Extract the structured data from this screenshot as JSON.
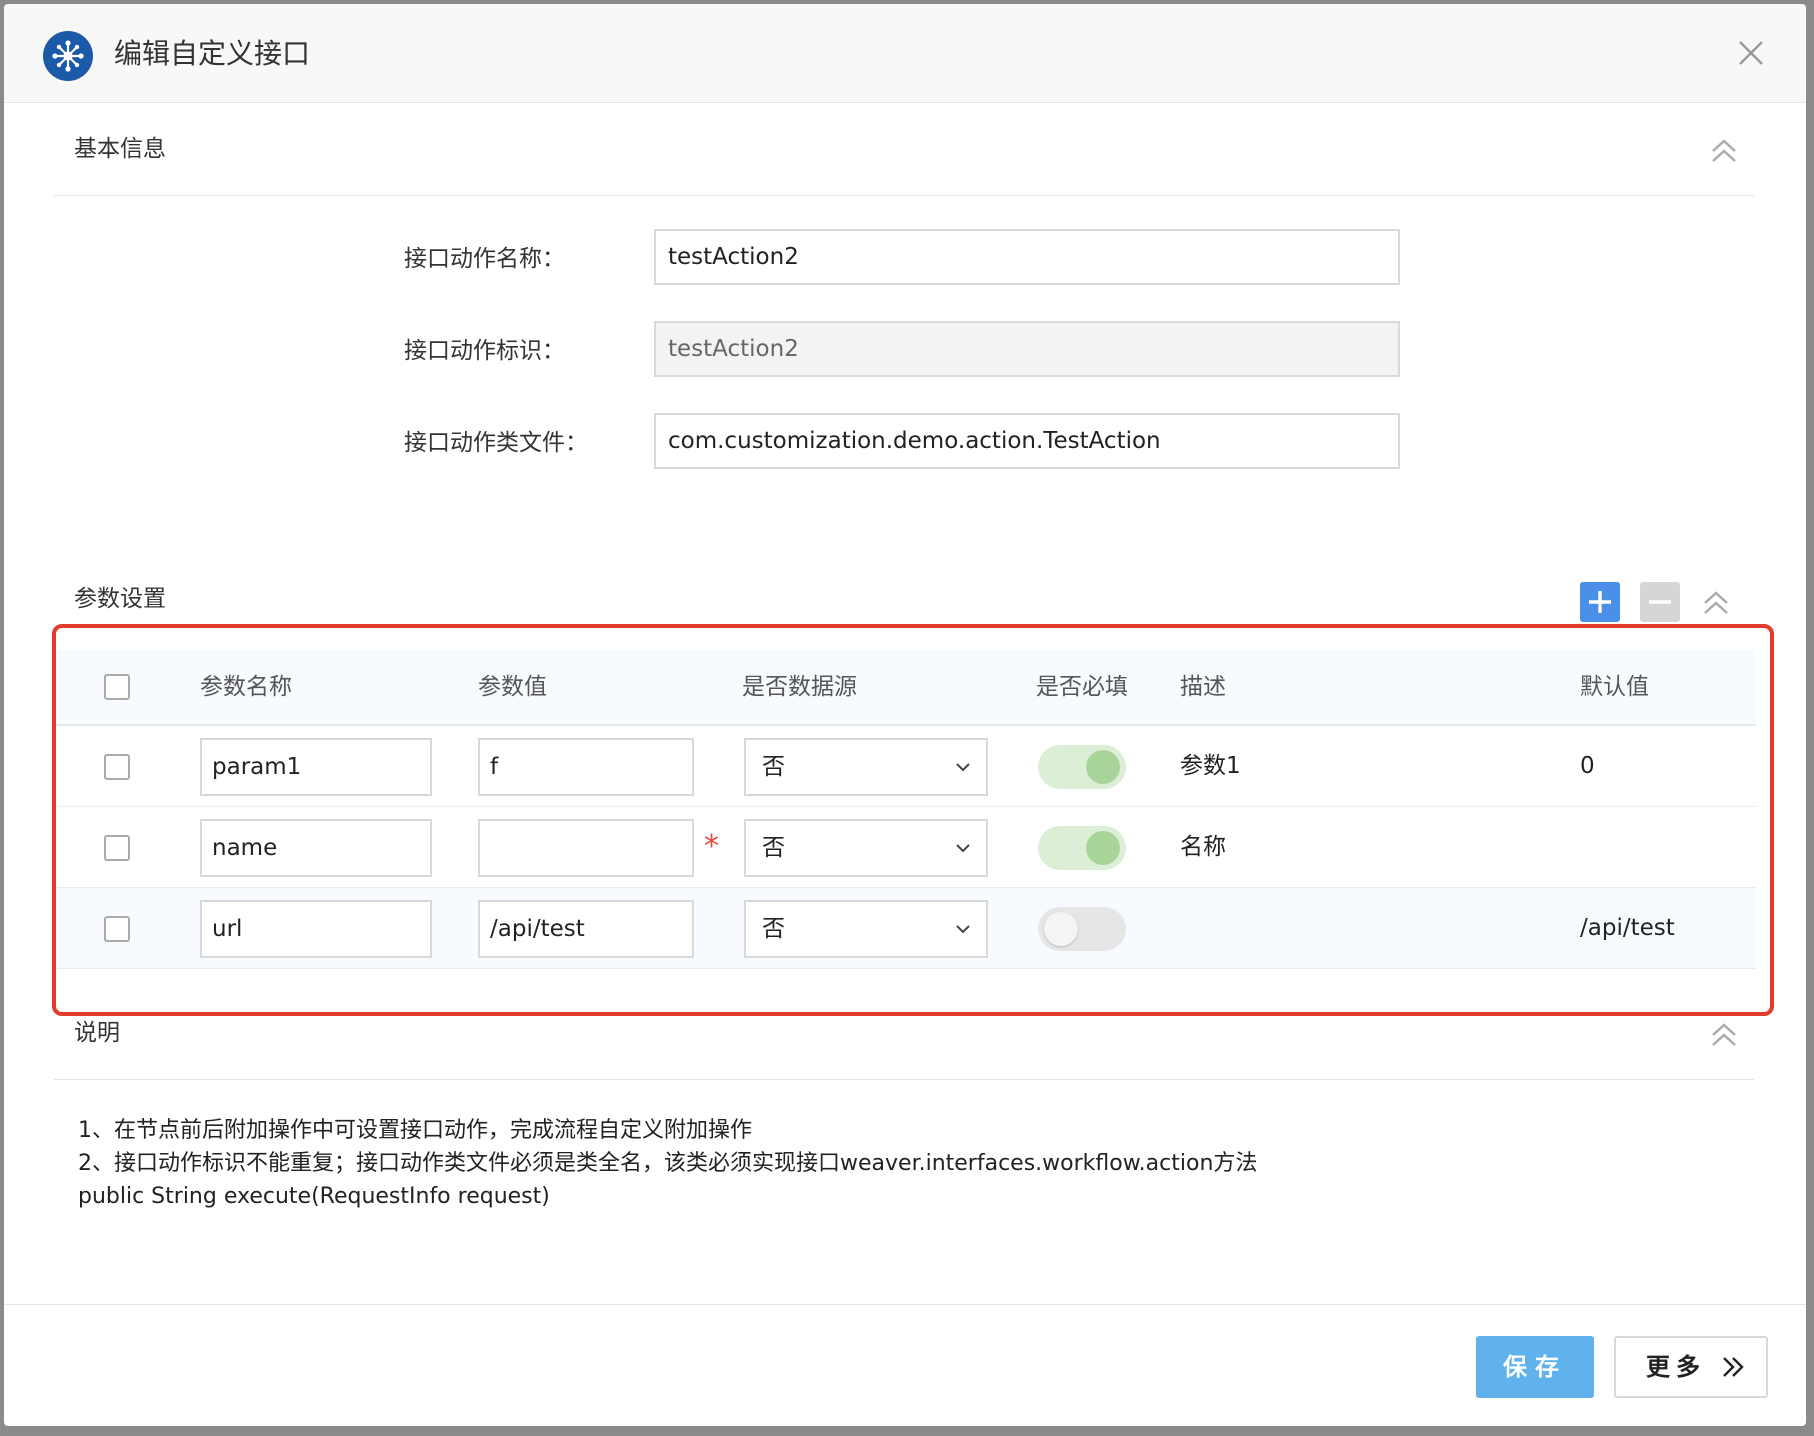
{
  "dialog": {
    "title": "编辑自定义接口"
  },
  "basic": {
    "section_title": "基本信息",
    "fields": [
      {
        "label": "接口动作名称：",
        "value": "testAction2",
        "disabled": false
      },
      {
        "label": "接口动作标识：",
        "value": "testAction2",
        "disabled": true
      },
      {
        "label": "接口动作类文件：",
        "value": "com.customization.demo.action.TestAction",
        "disabled": false
      }
    ]
  },
  "params": {
    "section_title": "参数设置",
    "columns": [
      "参数名称",
      "参数值",
      "是否数据源",
      "是否必填",
      "描述",
      "默认值"
    ],
    "rows": [
      {
        "name": "param1",
        "value": "f",
        "datasource": "否",
        "required": true,
        "desc": "参数1",
        "default": "0",
        "required_star": false
      },
      {
        "name": "name",
        "value": "",
        "datasource": "否",
        "required": true,
        "desc": "名称",
        "default": "",
        "required_star": true
      },
      {
        "name": "url",
        "value": "/api/test",
        "datasource": "否",
        "required": false,
        "desc": "",
        "default": "/api/test",
        "required_star": false
      }
    ],
    "star": "*"
  },
  "notes": {
    "section_title": "说明",
    "lines": [
      "1、在节点前后附加操作中可设置接口动作，完成流程自定义附加操作",
      "2、接口动作标识不能重复；接口动作类文件必须是类全名，该类必须实现接口weaver.interfaces.workflow.action方法",
      "public String execute(RequestInfo request)"
    ]
  },
  "footer": {
    "save_label": "保存",
    "more_label": "更多"
  },
  "colors": {
    "accent": "#5fb2ec",
    "add_button": "#4a90e8",
    "highlight": "#e23a2c",
    "toggle_on": "#a8d49a"
  }
}
